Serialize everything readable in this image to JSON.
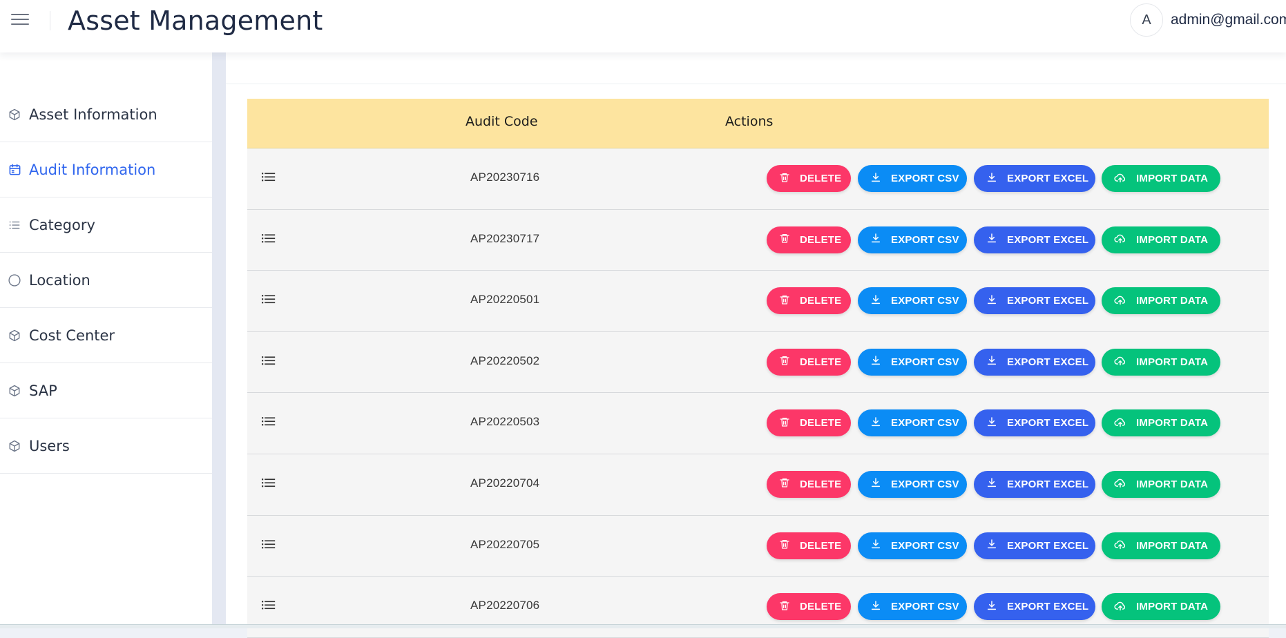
{
  "header": {
    "title": "Asset Management",
    "avatar_initial": "A",
    "user_email": "admin@gmail.com"
  },
  "sidebar": {
    "items": [
      {
        "label": "Asset Information",
        "icon": "cube-icon",
        "active": false
      },
      {
        "label": "Audit Information",
        "icon": "calendar-icon",
        "active": true
      },
      {
        "label": "Category",
        "icon": "list-icon",
        "active": false
      },
      {
        "label": "Location",
        "icon": "circle-icon",
        "active": false
      },
      {
        "label": "Cost Center",
        "icon": "cube-icon",
        "active": false
      },
      {
        "label": "SAP",
        "icon": "cube-icon",
        "active": false
      },
      {
        "label": "Users",
        "icon": "cube-icon",
        "active": false
      }
    ]
  },
  "table": {
    "columns": {
      "code": "Audit Code",
      "actions": "Actions"
    },
    "actions": {
      "delete": "DELETE",
      "export_csv": "EXPORT CSV",
      "export_excel": "EXPORT EXCEL",
      "import_data": "IMPORT DATA"
    },
    "rows": [
      {
        "code": "AP20230716"
      },
      {
        "code": "AP20230717"
      },
      {
        "code": "AP20220501"
      },
      {
        "code": "AP20220502"
      },
      {
        "code": "AP20220503"
      },
      {
        "code": "AP20220704"
      },
      {
        "code": "AP20220705"
      },
      {
        "code": "AP20220706"
      }
    ]
  },
  "colors": {
    "accent": "#3066ee",
    "header_row": "#fde49f",
    "delete": "#fc3768",
    "export_csv": "#0b8cf5",
    "export_excel": "#3561ee",
    "import_data": "#05c37c"
  }
}
